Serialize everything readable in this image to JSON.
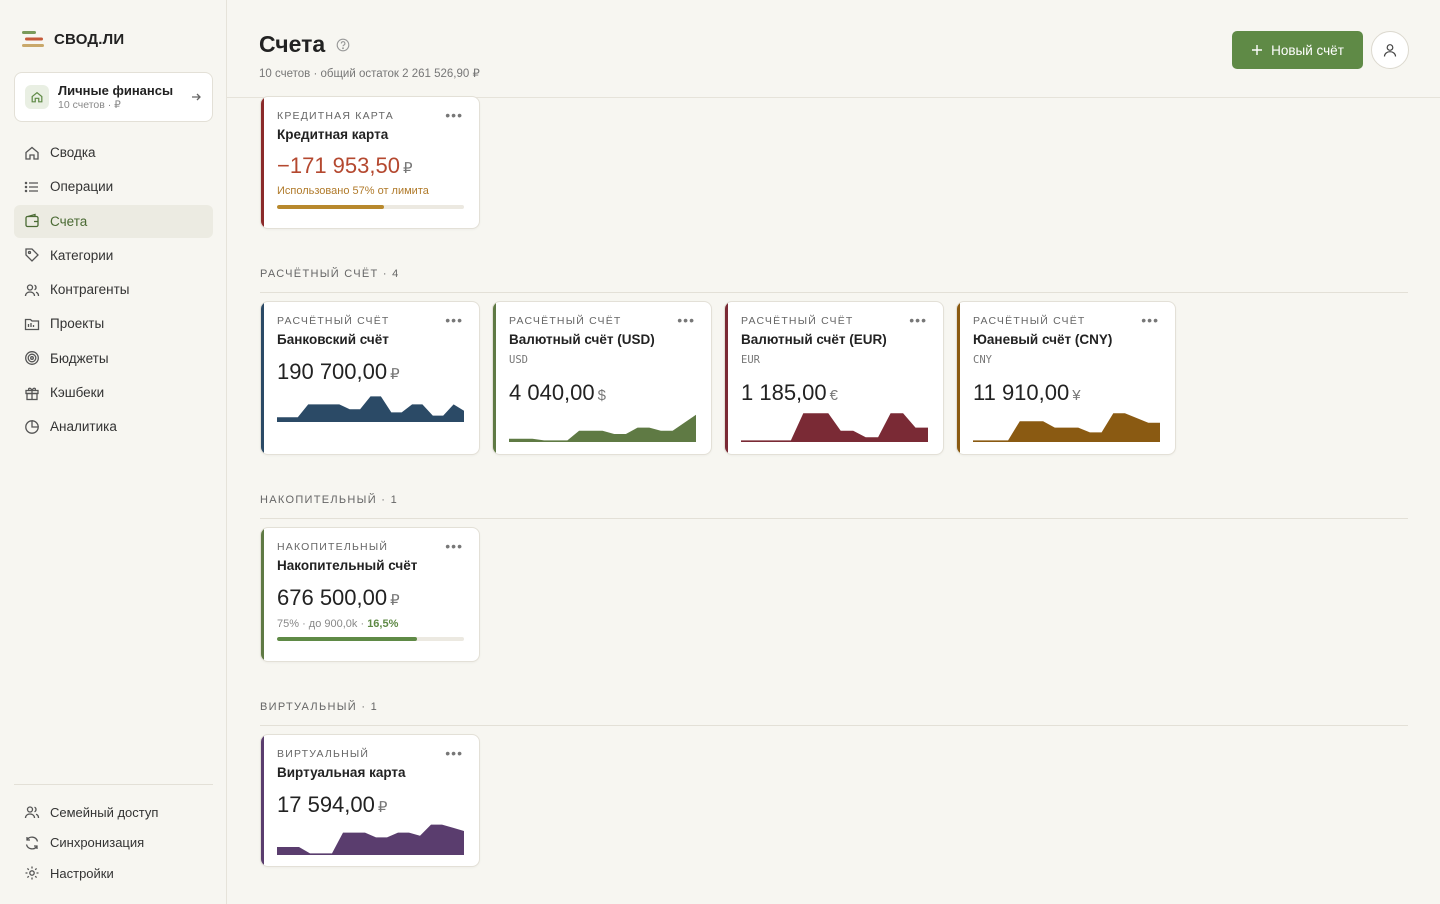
{
  "brand": {
    "name": "СВОД.ЛИ"
  },
  "workspace": {
    "name": "Личные финансы",
    "sub": "10 счетов · ₽"
  },
  "nav": [
    {
      "label": "Сводка",
      "icon": "home-icon",
      "active": false
    },
    {
      "label": "Операции",
      "icon": "list-icon",
      "active": false
    },
    {
      "label": "Счета",
      "icon": "wallet-icon",
      "active": true
    },
    {
      "label": "Категории",
      "icon": "tag-icon",
      "active": false
    },
    {
      "label": "Контрагенты",
      "icon": "users-icon",
      "active": false
    },
    {
      "label": "Проекты",
      "icon": "folder-icon",
      "active": false
    },
    {
      "label": "Бюджеты",
      "icon": "target-icon",
      "active": false
    },
    {
      "label": "Кэшбеки",
      "icon": "gift-icon",
      "active": false
    },
    {
      "label": "Аналитика",
      "icon": "pie-chart-icon",
      "active": false
    }
  ],
  "nav_bottom": [
    {
      "label": "Семейный доступ",
      "icon": "family-icon"
    },
    {
      "label": "Синхронизация",
      "icon": "sync-icon"
    },
    {
      "label": "Настройки",
      "icon": "gear-icon"
    }
  ],
  "header": {
    "title": "Счета",
    "subtitle": "10 счетов · общий остаток 2 261 526,90 ₽",
    "new_button": "Новый счёт"
  },
  "sections": [
    {
      "label": "РАСЧЁТНЫЙ СЧЁТ · 4"
    },
    {
      "label": "НАКОПИТЕЛЬНЫЙ · 1"
    },
    {
      "label": "ВИРТУАЛЬНЫЙ · 1"
    }
  ],
  "cards": {
    "credit": {
      "type": "КРЕДИТНАЯ КАРТА",
      "name": "Кредитная карта",
      "amount": "−171 953,50",
      "symbol": "₽",
      "note": "Использовано 57% от лимита",
      "progress": 0.57,
      "color": "#8b2a2a",
      "bar_color": "#b8892d",
      "amount_color": "#b4482f"
    },
    "bank": {
      "type": "РАСЧЁТНЫЙ СЧЁТ",
      "name": "Банковский счёт",
      "amount": "190 700,00",
      "symbol": "₽",
      "color": "#2b4a66",
      "spark": [
        0.15,
        0.15,
        0.15,
        0.55,
        0.55,
        0.55,
        0.55,
        0.4,
        0.4,
        0.8,
        0.8,
        0.3,
        0.3,
        0.55,
        0.55,
        0.2,
        0.2,
        0.55,
        0.35
      ]
    },
    "usd": {
      "type": "РАСЧЁТНЫЙ СЧЁТ",
      "name": "Валютный счёт (USD)",
      "currency": "USD",
      "amount": "4 040,00",
      "symbol": "$",
      "color": "#5f7a44",
      "spark": [
        0.1,
        0.1,
        0.1,
        0.05,
        0.05,
        0.05,
        0.35,
        0.35,
        0.35,
        0.25,
        0.25,
        0.45,
        0.45,
        0.35,
        0.35,
        0.6,
        0.85
      ]
    },
    "eur": {
      "type": "РАСЧЁТНЫЙ СЧЁТ",
      "name": "Валютный счёт (EUR)",
      "currency": "EUR",
      "amount": "1 185,00",
      "symbol": "€",
      "color": "#7a2a35",
      "spark": [
        0.05,
        0.05,
        0.05,
        0.05,
        0.05,
        0.9,
        0.9,
        0.9,
        0.35,
        0.35,
        0.15,
        0.15,
        0.9,
        0.9,
        0.45,
        0.45
      ]
    },
    "cny": {
      "type": "РАСЧЁТНЫЙ СЧЁТ",
      "name": "Юаневый счёт (CNY)",
      "currency": "CNY",
      "amount": "11 910,00",
      "symbol": "¥",
      "color": "#8a5a12",
      "spark": [
        0.05,
        0.05,
        0.05,
        0.05,
        0.65,
        0.65,
        0.65,
        0.45,
        0.45,
        0.45,
        0.3,
        0.3,
        0.9,
        0.9,
        0.75,
        0.6,
        0.6
      ]
    },
    "savings": {
      "type": "НАКОПИТЕЛЬНЫЙ",
      "name": "Накопительный счёт",
      "amount": "676 500,00",
      "symbol": "₽",
      "note": "75% · до 900,0k · ",
      "rate": "16,5%",
      "progress": 0.75,
      "color": "#5f7a44",
      "bar_color": "#5f8a46"
    },
    "virtual": {
      "type": "ВИРТУАЛЬНЫЙ",
      "name": "Виртуальная карта",
      "amount": "17 594,00",
      "symbol": "₽",
      "color": "#5a3d6e",
      "spark": [
        0.25,
        0.25,
        0.25,
        0.05,
        0.05,
        0.05,
        0.7,
        0.7,
        0.7,
        0.55,
        0.55,
        0.7,
        0.7,
        0.6,
        0.95,
        0.95,
        0.85,
        0.75
      ]
    }
  }
}
